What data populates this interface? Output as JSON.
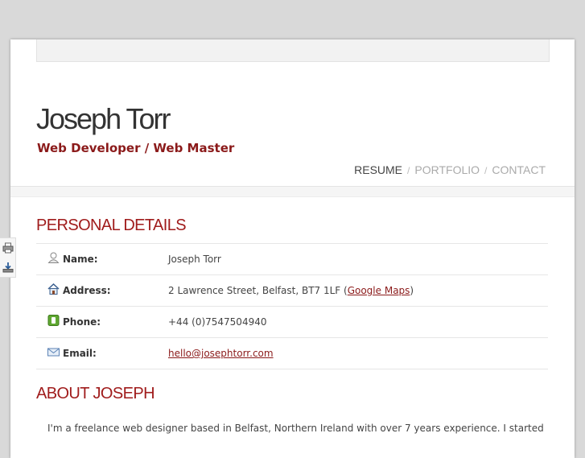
{
  "header": {
    "name": "Joseph Torr",
    "subtitle": "Web Developer / Web Master"
  },
  "nav": {
    "items": [
      "RESUME",
      "PORTFOLIO",
      "CONTACT"
    ],
    "separator": "/"
  },
  "personal_details": {
    "title": "PERSONAL DETAILS",
    "rows": [
      {
        "label": "Name:",
        "value": "Joseph Torr",
        "icon": "user-icon"
      },
      {
        "label": "Address:",
        "value": "2 Lawrence Street, Belfast, BT7 1LF (",
        "link": "Google Maps",
        "suffix": ")",
        "icon": "house-icon"
      },
      {
        "label": "Phone:",
        "value": "+44 (0)7547504940",
        "icon": "phone-icon"
      },
      {
        "label": "Email:",
        "link": "hello@josephtorr.com",
        "icon": "mail-icon"
      }
    ]
  },
  "about": {
    "title": "ABOUT JOSEPH",
    "text": "I'm a freelance web designer based in Belfast, Northern Ireland with over 7 years experience. I started"
  },
  "side_tools": [
    "print-icon",
    "download-icon"
  ],
  "colors": {
    "accent": "#a01c1c",
    "background": "#d9d9d9"
  }
}
